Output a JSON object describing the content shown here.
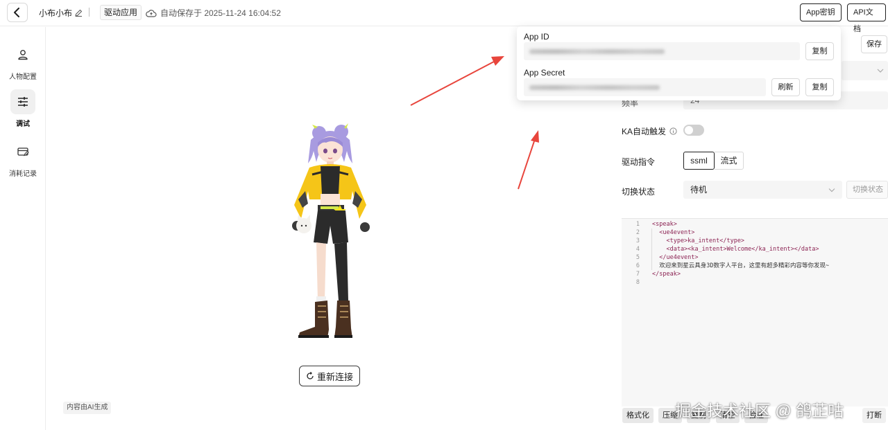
{
  "header": {
    "app_name": "小布小布",
    "tag": "驱动应用",
    "autosave": "自动保存于 2025-11-24 16:04:52",
    "app_key_button": "App密钥",
    "api_doc_button": "API文档"
  },
  "sidebar": {
    "items": [
      {
        "label": "人物配置",
        "icon": "person-icon"
      },
      {
        "label": "调试",
        "icon": "sliders-icon",
        "active": true
      },
      {
        "label": "消耗记录",
        "icon": "card-edit-icon"
      }
    ]
  },
  "stage": {
    "reconnect_button": "重新连接",
    "ai_note": "内容由AI生成"
  },
  "panel": {
    "save_button": "保存",
    "partial_label": "频率",
    "partial_value": "24",
    "ka_label": "KA自动触发",
    "drive_label": "驱动指令",
    "drive_options": [
      "ssml",
      "流式"
    ],
    "state_label": "切换状态",
    "state_value": "待机",
    "switch_button": "切换状态"
  },
  "editor": {
    "lines": [
      {
        "n": "1",
        "code": "<speak>"
      },
      {
        "n": "2",
        "code": "  <ue4event>"
      },
      {
        "n": "3",
        "code": "    <type>ka_intent</type>"
      },
      {
        "n": "4",
        "code": "    <data><ka_intent>Welcome</ka_intent></data>"
      },
      {
        "n": "5",
        "code": "  </ue4event>"
      },
      {
        "n": "6",
        "code": "  欢迎来到星云具身3D数字人平台，这里有超多精彩内容等你发现~"
      },
      {
        "n": "7",
        "code": "</speak>"
      },
      {
        "n": "8",
        "code": ""
      }
    ],
    "buttons": [
      "格式化",
      "压缩",
      "复制",
      "清空",
      "验证"
    ],
    "interrupt_button": "打断"
  },
  "popover": {
    "app_id_label": "App ID",
    "app_secret_label": "App Secret",
    "copy_button": "复制",
    "refresh_button": "刷新"
  },
  "watermark": "掘金技术社区 @ 鸽芷咕",
  "colors": {
    "arrow": "#e8453c",
    "hair": "#a89be0",
    "jacket": "#f5c518",
    "dark": "#2b2b2b"
  }
}
